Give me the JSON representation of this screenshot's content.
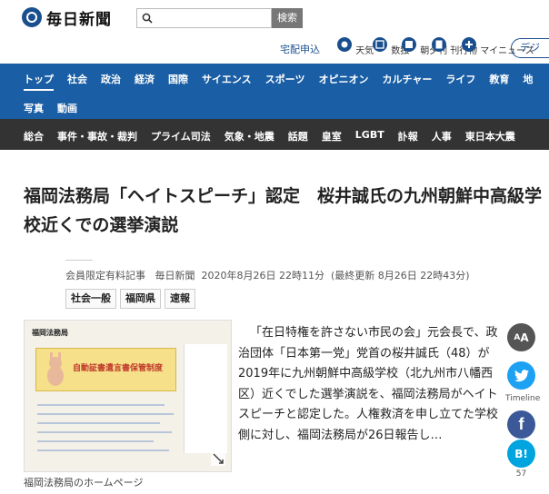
{
  "header": {
    "logo_text": "毎日新聞",
    "search_button": "検索",
    "delivery_link": "宅配申込",
    "digital_button": "デジ",
    "utilities": [
      {
        "label": "天気",
        "icon": "weather-icon"
      },
      {
        "label": "数独",
        "icon": "sudoku-icon"
      },
      {
        "label": "朝夕刊",
        "icon": "newspaper-icon"
      },
      {
        "label": "刊行物",
        "icon": "publication-icon"
      },
      {
        "label": "マイニュース",
        "icon": "mynews-icon"
      }
    ]
  },
  "nav_primary": {
    "row1": [
      "トップ",
      "社会",
      "政治",
      "経済",
      "国際",
      "サイエンス",
      "スポーツ",
      "オピニオン",
      "カルチャー",
      "ライフ",
      "教育",
      "地"
    ],
    "row2": [
      "写真",
      "動画"
    ],
    "active": "トップ"
  },
  "nav_secondary": [
    "総合",
    "事件・事故・裁判",
    "プライム司法",
    "気象・地震",
    "話題",
    "皇室",
    "LGBT",
    "訃報",
    "人事",
    "東日本大震"
  ],
  "article": {
    "title": "福岡法務局「ヘイトスピーチ」認定　桜井誠氏の九州朝鮮中高級学校近くでの選挙演説",
    "member_label": "会員限定有料記事",
    "publisher": "毎日新聞",
    "date": "2020年8月26日 22時11分",
    "updated": "(最終更新 8月26日 22時43分)",
    "tags": [
      "社会一般",
      "福岡県",
      "速報"
    ],
    "photo_title": "福岡法務局",
    "photo_banner": "自動証書遺言書保管制度",
    "caption": "福岡法務局のホームページ",
    "body": "「在日特権を許さない市民の会」元会長で、政治団体「日本第一党」党首の桜井誠氏（48）が2019年に九州朝鮮中高級学校（北九州市八幡西区）近くでした選挙演説を、福岡法務局がヘイトスピーチと認定した。人権救済を申し立てた学校側に対し、福岡法務局が26日報告し…"
  },
  "share": {
    "font_size_label": "A",
    "timeline_label": "Timeline",
    "hatena_label": "B!",
    "hatena_count": "57"
  },
  "colors": {
    "brand_blue": "#1a5ea5",
    "dark_nav": "#333333"
  }
}
